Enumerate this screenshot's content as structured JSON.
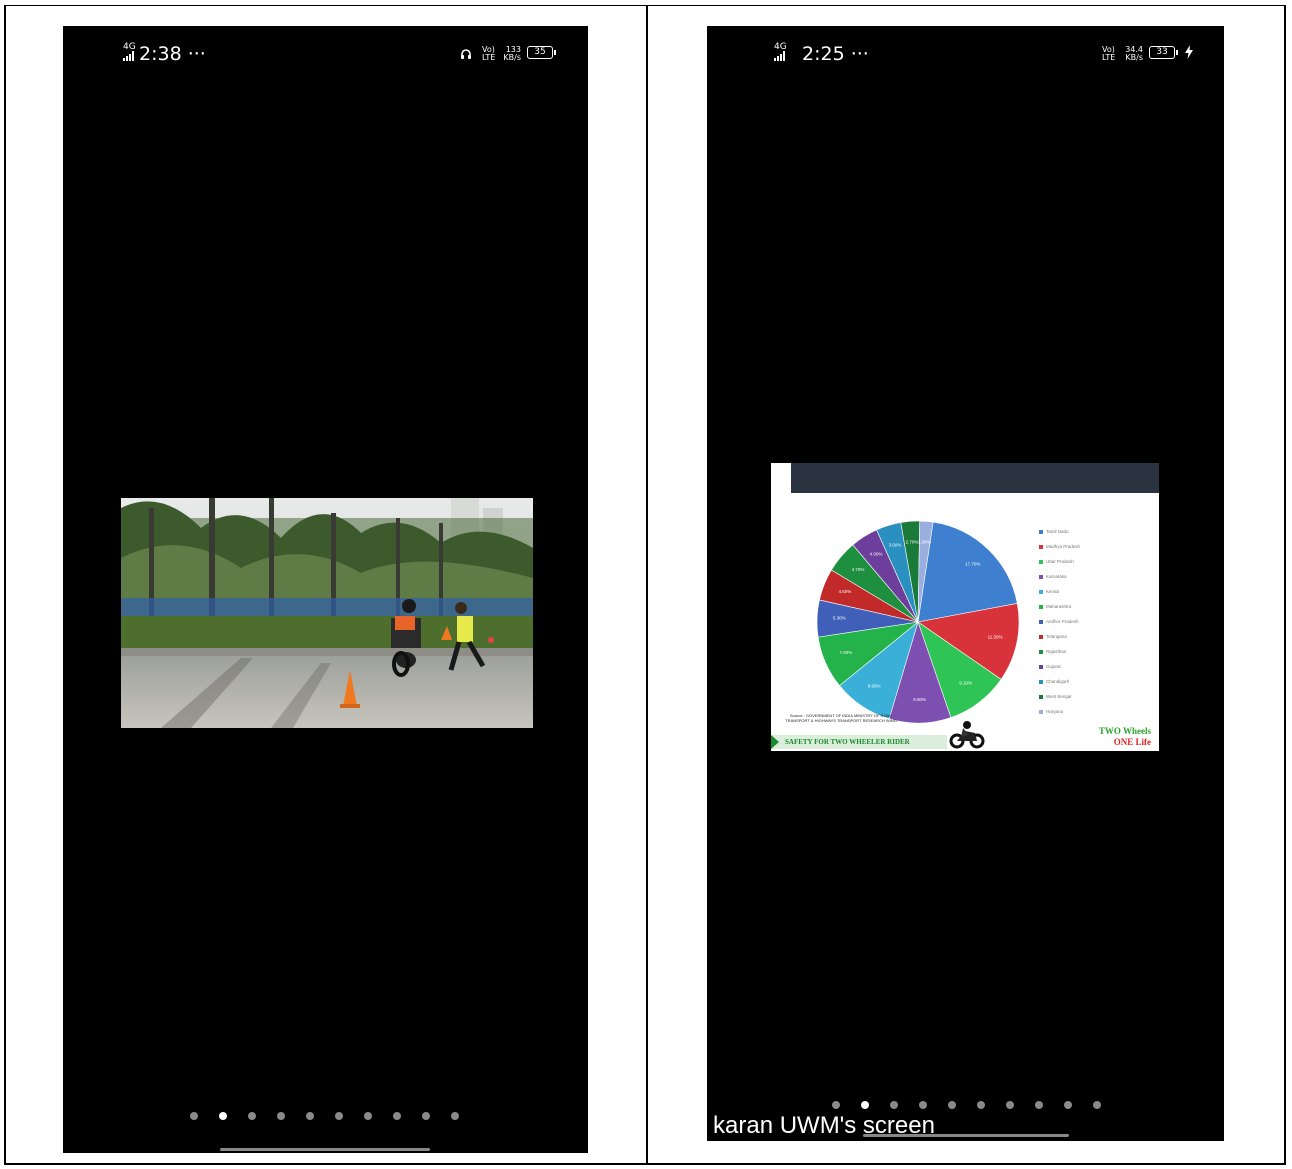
{
  "left_phone": {
    "status": {
      "time": "2:38 ···",
      "network": "4G",
      "data_speed": "133",
      "data_unit": "KB/s",
      "volte": "Vo)",
      "lte": "LTE",
      "battery": "35",
      "headphone_icon": "headphone-icon"
    },
    "pager": {
      "count": 10,
      "active_index": 1
    }
  },
  "right_phone": {
    "status": {
      "time": "2:25 ···",
      "network": "4G",
      "data_speed": "34.4",
      "data_unit": "KB/s",
      "volte": "Vo)",
      "lte": "LTE",
      "battery": "33",
      "charging_icon": "bolt-icon"
    },
    "pager": {
      "count": 10,
      "active_index": 1
    },
    "screen_share_caption": "karan UWM's screen",
    "slide": {
      "source_note": "Source : GOVERNMENT OF INDIA MINISTRY OF ROAD TRANSPORT & HIGHWAYS TRANSPORT RESEARCH WING",
      "footer_banner": "SAFETY FOR TWO WHEELER RIDER",
      "brand_line1": "TWO Wheels",
      "brand_line2": "ONE Life"
    }
  },
  "chart_data": {
    "type": "pie",
    "series": [
      {
        "name": "Tamil Nadu",
        "value": 17.7,
        "label": "17.70%",
        "color": "#3e7fcf"
      },
      {
        "name": "Madhya Pradesh",
        "value": 11.3,
        "label": "11.30%",
        "color": "#d8333a"
      },
      {
        "name": "Uttar Pradesh",
        "value": 9.1,
        "label": "9.10%",
        "color": "#2ec456"
      },
      {
        "name": "Karnataka",
        "value": 8.9,
        "label": "8.90%",
        "color": "#7c4fb0"
      },
      {
        "name": "Kerala",
        "value": 8.6,
        "label": "8.60%",
        "color": "#3ab0d8"
      },
      {
        "name": "Maharashtra",
        "value": 7.6,
        "label": "7.60%",
        "color": "#23b34a"
      },
      {
        "name": "Andhra Pradesh",
        "value": 5.3,
        "label": "5.30%",
        "color": "#3f5fb8"
      },
      {
        "name": "Telangana",
        "value": 4.6,
        "label": "4.60%",
        "color": "#c22a2a"
      },
      {
        "name": "Rajasthan",
        "value": 4.7,
        "label": "4.70%",
        "color": "#1e8f3e"
      },
      {
        "name": "Gujarat",
        "value": 4.0,
        "label": "4.00%",
        "color": "#6e3e9c"
      },
      {
        "name": "Chandigarh",
        "value": 3.6,
        "label": "3.60%",
        "color": "#2a90c0"
      },
      {
        "name": "West Bengal",
        "value": 2.7,
        "label": "2.70%",
        "color": "#1a7a3a"
      },
      {
        "name": "Haryana",
        "value": 1.9,
        "label": "1.90%",
        "color": "#9aaee0"
      }
    ]
  }
}
